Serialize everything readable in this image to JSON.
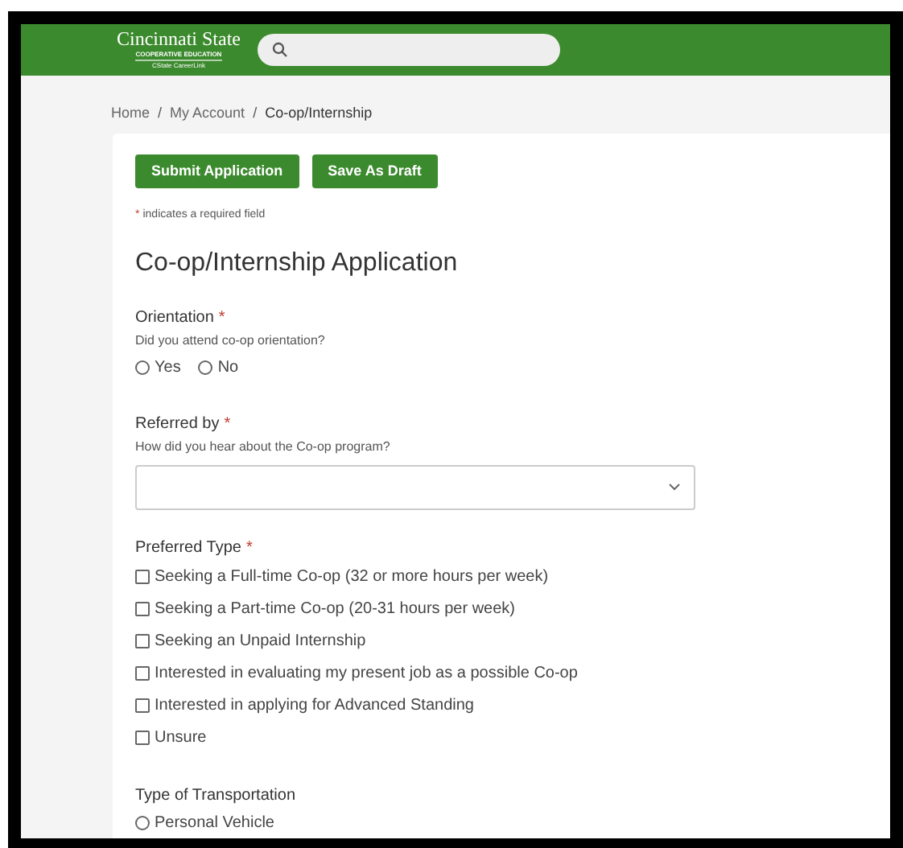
{
  "header": {
    "logo": {
      "name": "Cincinnati State",
      "line_1": "COOPERATIVE EDUCATION",
      "line_2": "CState CareerLink"
    }
  },
  "breadcrumb": {
    "separator": "/",
    "items": [
      "Home",
      "My Account",
      "Co-op/Internship"
    ]
  },
  "buttons": [
    "Submit Application",
    "Save As Draft"
  ],
  "required_note": {
    "mark": "*",
    "text": "indicates a required field"
  },
  "form_title": "Co-op/Internship Application",
  "fields": [
    {
      "kind": "radio",
      "label": "Orientation",
      "required": true,
      "hint": "Did you attend co-op orientation?",
      "options": [
        {
          "label": "Yes",
          "selected": false
        },
        {
          "label": "No",
          "selected": false
        }
      ]
    },
    {
      "kind": "select",
      "label": "Referred by",
      "required": true,
      "hint": "How did you hear about the Co-op program?"
    },
    {
      "kind": "checkbox",
      "label": "Preferred Type",
      "required": true,
      "options": [
        {
          "label": "Seeking a Full-time Co-op (32 or more hours per week)",
          "checked": false
        },
        {
          "label": "Seeking a Part-time Co-op (20-31 hours per week)",
          "checked": false
        },
        {
          "label": "Seeking an Unpaid Internship",
          "checked": false
        },
        {
          "label": "Interested in evaluating my present job as a possible Co-op",
          "checked": false
        },
        {
          "label": "Interested in applying for Advanced Standing",
          "checked": false
        },
        {
          "label": "Unsure",
          "checked": false
        }
      ]
    },
    {
      "kind": "radio",
      "label": "Type of Transportation",
      "required": false,
      "options": [
        {
          "label": "Personal Vehicle",
          "selected": false
        }
      ]
    }
  ]
}
